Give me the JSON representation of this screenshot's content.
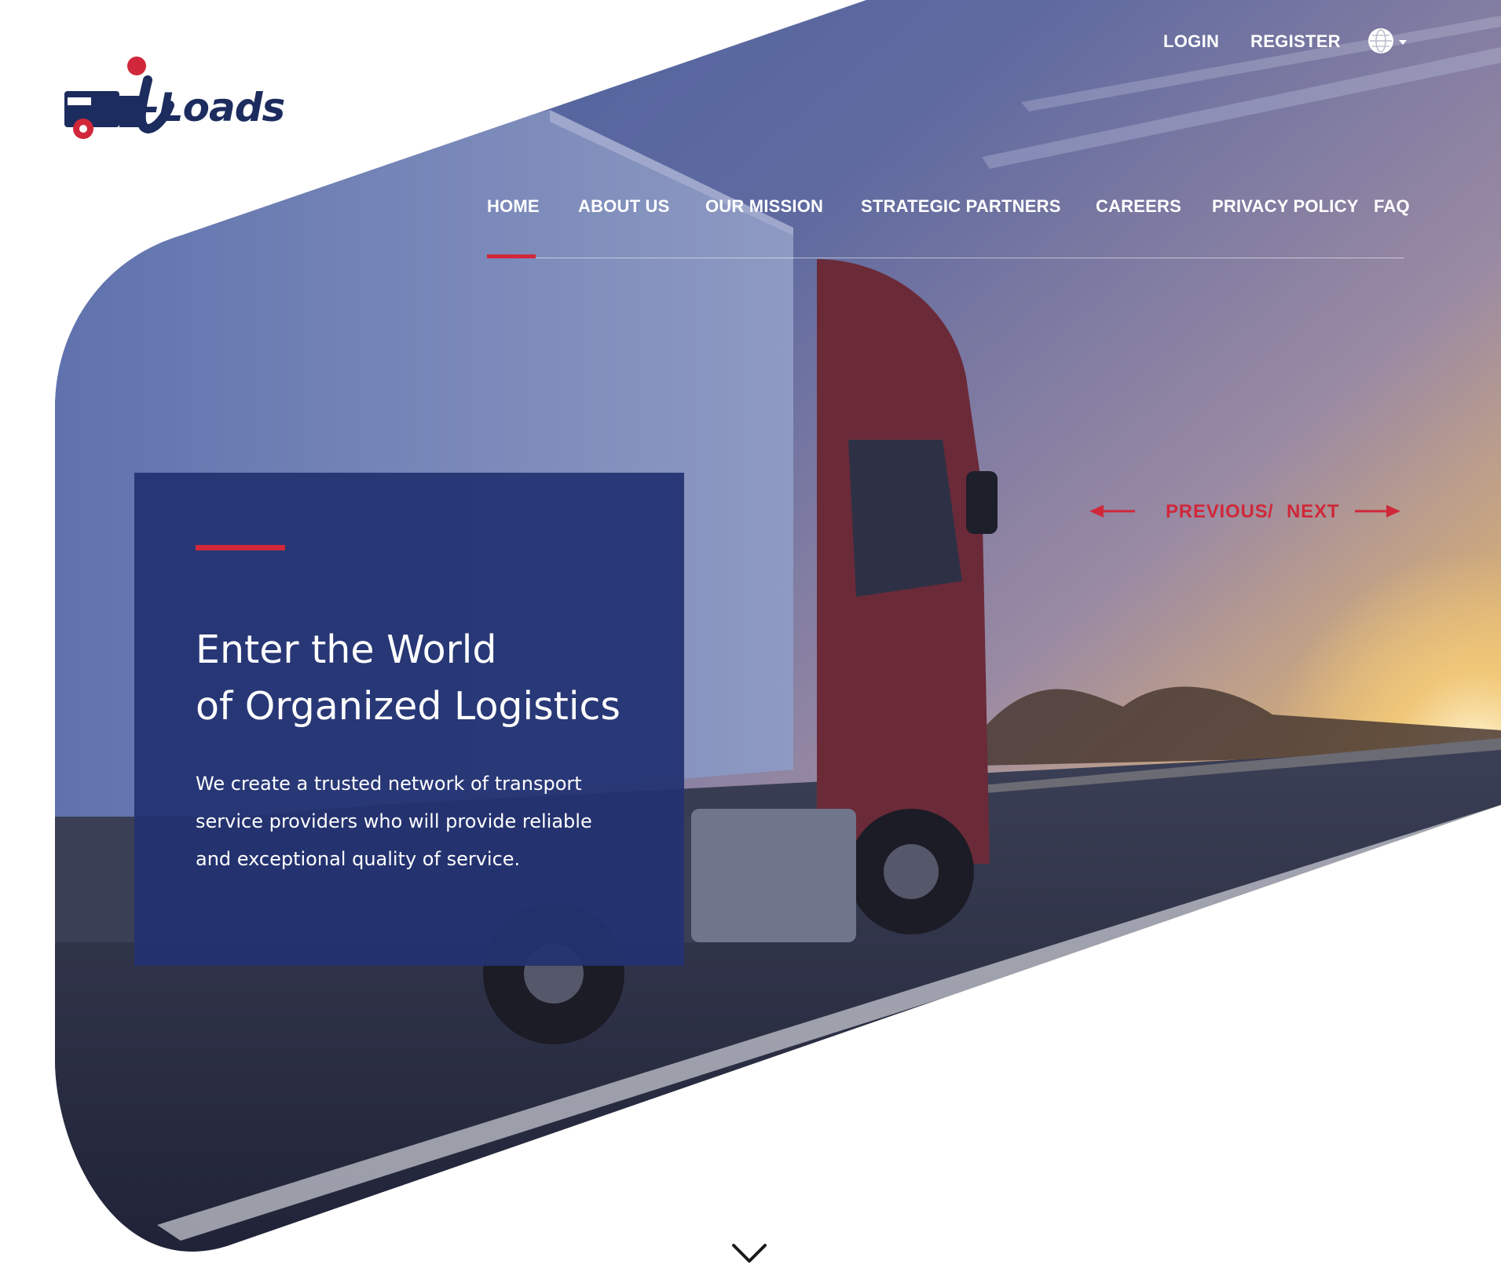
{
  "brand": {
    "logo_text": "-Loads",
    "icon": "truck-i-logo-icon"
  },
  "top_links": {
    "login": "LOGIN",
    "register": "REGISTER",
    "language_icon": "globe-icon"
  },
  "nav": {
    "items": [
      {
        "label": "HOME",
        "active": true
      },
      {
        "label": "ABOUT US",
        "active": false
      },
      {
        "label": "OUR MISSION",
        "active": false
      },
      {
        "label": "STRATEGIC PARTNERS",
        "active": false
      },
      {
        "label": "CAREERS",
        "active": false
      },
      {
        "label": "PRIVACY POLICY",
        "active": false
      },
      {
        "label": "FAQ",
        "active": false
      }
    ]
  },
  "slider": {
    "previous": "PREVIOUS",
    "separator": "/",
    "next": "NEXT"
  },
  "hero": {
    "title_line1": "Enter the World",
    "title_line2": "of Organized Logistics",
    "description": "We create a trusted network of transport service providers who will provide reliable and exceptional quality of service."
  },
  "colors": {
    "accent": "#d0283a",
    "navy": "#223271",
    "brand_dark": "#1d2c5e"
  }
}
